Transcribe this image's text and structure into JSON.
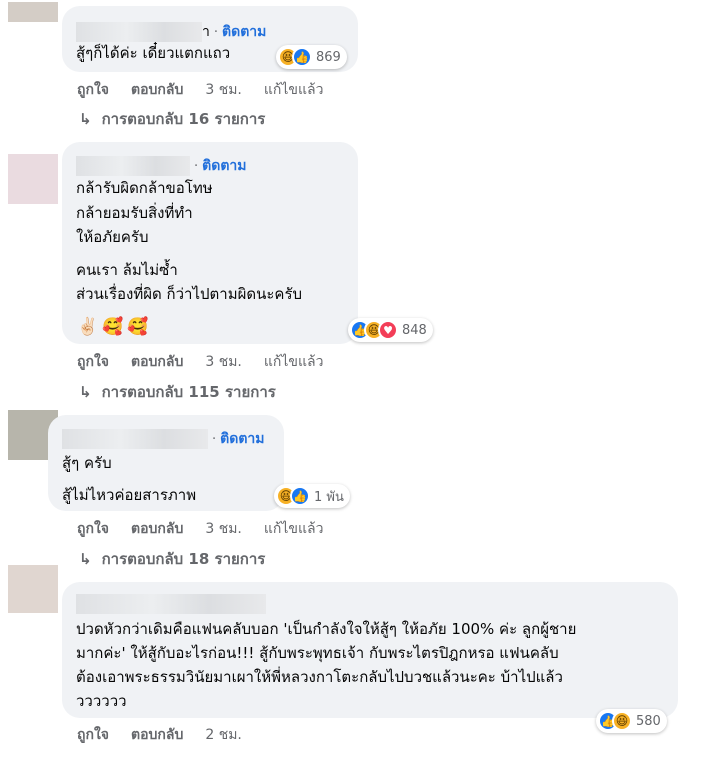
{
  "comments": [
    {
      "name_suffix": "า",
      "separator": "·",
      "follow": "ติดตาม",
      "lines": [
        "สู้ๆก็ได้ค่ะ เดี๋ยวแตกแถว"
      ],
      "reaction_count": "869",
      "like": "ถูกใจ",
      "reply": "ตอบกลับ",
      "time": "3 ชม.",
      "edited": "แก้ไขแล้ว",
      "replies": "การตอบกลับ 16 รายการ"
    },
    {
      "separator": "·",
      "follow": "ติดตาม",
      "lines": [
        "กล้ารับผิดกล้าขอโทษ",
        "กล้ายอมรับสิ่งที่ทำ",
        "ให้อภัยครับ",
        "คนเรา ล้มไม่ซ้ำ",
        "ส่วนเรื่องที่ผิด ก็ว่าไปตามผิดนะครับ"
      ],
      "emojis": [
        "✌🏻",
        "🥰",
        "🥰"
      ],
      "reaction_count": "848",
      "like": "ถูกใจ",
      "reply": "ตอบกลับ",
      "time": "3 ชม.",
      "edited": "แก้ไขแล้ว",
      "replies": "การตอบกลับ 115 รายการ"
    },
    {
      "separator": "·",
      "follow": "ติดตาม",
      "lines": [
        "สู้ๆ ครับ",
        "สู้ไม่ไหวค่อยสารภาพ"
      ],
      "reaction_count": "1 พัน",
      "like": "ถูกใจ",
      "reply": "ตอบกลับ",
      "time": "3 ชม.",
      "edited": "แก้ไขแล้ว",
      "replies": "การตอบกลับ 18 รายการ"
    },
    {
      "lines": [
        "ปวดหัวกว่าเดิมคือแฟนคลับบอก 'เป็นกำลังใจให้สู้ๆ ให้อภัย 100% ค่ะ ลูกผู้ชาย",
        "มากค่ะ' ให้สู้กับอะไรก่อน!!! สู้กับพระพุทธเจ้า กับพระไตรปิฎกหรอ แฟนคลับ",
        "ต้องเอาพระธรรมวินัยมาเผาให้พี่หลวงกาโตะกลับไปบวชแล้วนะคะ บ้าไปแล้ว",
        "วววววว"
      ],
      "reaction_count": "580",
      "like": "ถูกใจ",
      "reply": "ตอบกลับ",
      "time": "2 ชม."
    }
  ],
  "colors": {
    "bubble": "#f0f2f5",
    "follow": "#216fdb",
    "meta": "#65676b",
    "like": "#1877f2",
    "love": "#f33e58",
    "haha": "#f7b125"
  }
}
